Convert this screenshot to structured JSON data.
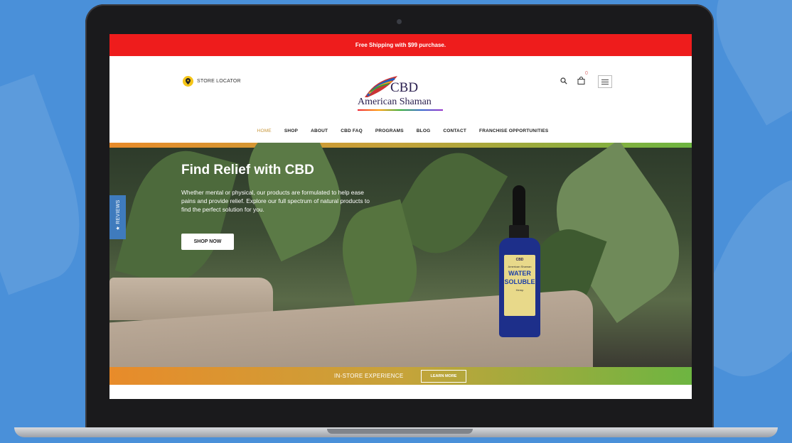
{
  "promo": {
    "text": "Free Shipping with $99 purchase."
  },
  "header": {
    "store_locator": "STORE LOCATOR",
    "logo": {
      "line1": "CBD",
      "line2": "American Shaman"
    },
    "cart_count": "0"
  },
  "nav": {
    "items": [
      {
        "label": "HOME",
        "active": true
      },
      {
        "label": "SHOP"
      },
      {
        "label": "ABOUT"
      },
      {
        "label": "CBD FAQ"
      },
      {
        "label": "PROGRAMS"
      },
      {
        "label": "BLOG"
      },
      {
        "label": "CONTACT"
      },
      {
        "label": "FRANCHISE OPPORTUNITIES"
      }
    ]
  },
  "hero": {
    "title": "Find Relief with CBD",
    "text": "Whether mental or physical, our products are formulated to help ease pains and provide relief. Explore our full spectrum of natural products to find the perfect solution for you.",
    "button": "SHOP NOW"
  },
  "reviews_tab": "★ REVIEWS",
  "product_label": {
    "top": "CBD",
    "brand": "American Shaman",
    "line1": "WATER",
    "line2": "SOLUBLE",
    "flavor": "Hemp"
  },
  "instore": {
    "text": "IN-STORE EXPERIENCE",
    "button": "LEARN MORE"
  },
  "colors": {
    "promo": "#ee1c1c",
    "active_nav": "#c8963a",
    "gradient_start": "#e88b2a",
    "gradient_end": "#6db541",
    "reviews_tab": "#3f7bbd",
    "background": "#4a90d9"
  },
  "icons": [
    "map-pin-icon",
    "search-icon",
    "shopping-bag-icon",
    "hamburger-menu-icon",
    "feather-logo-icon"
  ]
}
